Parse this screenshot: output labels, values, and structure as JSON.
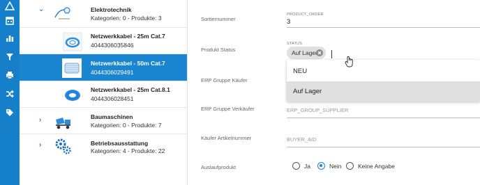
{
  "rail": {
    "icons": [
      "warning-icon",
      "calendar-icon",
      "bar-chart-icon",
      "funnel-icon",
      "printer-icon",
      "shuffle-icon",
      "tag-icon"
    ]
  },
  "tree": {
    "items": [
      {
        "title": "Elektrotechnik",
        "subtitle": "Kategorien: 0 - Produkte: 3",
        "chevron": "⌄",
        "icon": "cable-reel-icon"
      },
      {
        "title": "Netzwerkkabel - 25m Cat.7",
        "subtitle": "4044306035846",
        "icon": "blue-cable-icon"
      },
      {
        "title": "Netzwerkkabel - 50m Cat.7",
        "subtitle": "4044306029491",
        "icon": "cable-drum-icon"
      },
      {
        "title": "Netzwerkkabel - 25m Cat.8.1",
        "subtitle": "4044306028451",
        "icon": "blue-cable-icon"
      },
      {
        "title": "Baumaschinen",
        "subtitle": "Kategorien: 0 - Produkte: 7",
        "chevron": "›",
        "icon": "cement-mixer-icon"
      },
      {
        "title": "Betriebsausstattung",
        "subtitle": "Kategorien: 4 - Produkte: 22",
        "chevron": "›",
        "icon": "gears-icon"
      }
    ]
  },
  "form": {
    "sortiernummer": {
      "label": "Sortiernummer",
      "field_label": "PRODUCT_ORDER",
      "value": "3"
    },
    "status": {
      "label": "Produkt Status",
      "field_label": "STATUS",
      "chip": "Auf Lager",
      "options": [
        "NEU",
        "Auf Lager"
      ],
      "selected_option": "Auf Lager"
    },
    "erp_kaeufer": {
      "label": "ERP Gruppe Käufer"
    },
    "erp_verkaeufer": {
      "label": "ERP Gruppe Verkäufer",
      "placeholder": "ERP_GROUP_SUPPLIER"
    },
    "kaeufer_artikel": {
      "label": "Käufer Artikelnummer",
      "placeholder": "BUYER_AID"
    },
    "auslaufprodukt": {
      "label": "Auslaufprodukt",
      "options": [
        "Ja",
        "Nein",
        "Keine Angabe"
      ],
      "selected": "Nein"
    }
  },
  "colors": {
    "rail": "#1580c9",
    "selected": "#1a85d0",
    "chip": "#e0e0e0"
  }
}
